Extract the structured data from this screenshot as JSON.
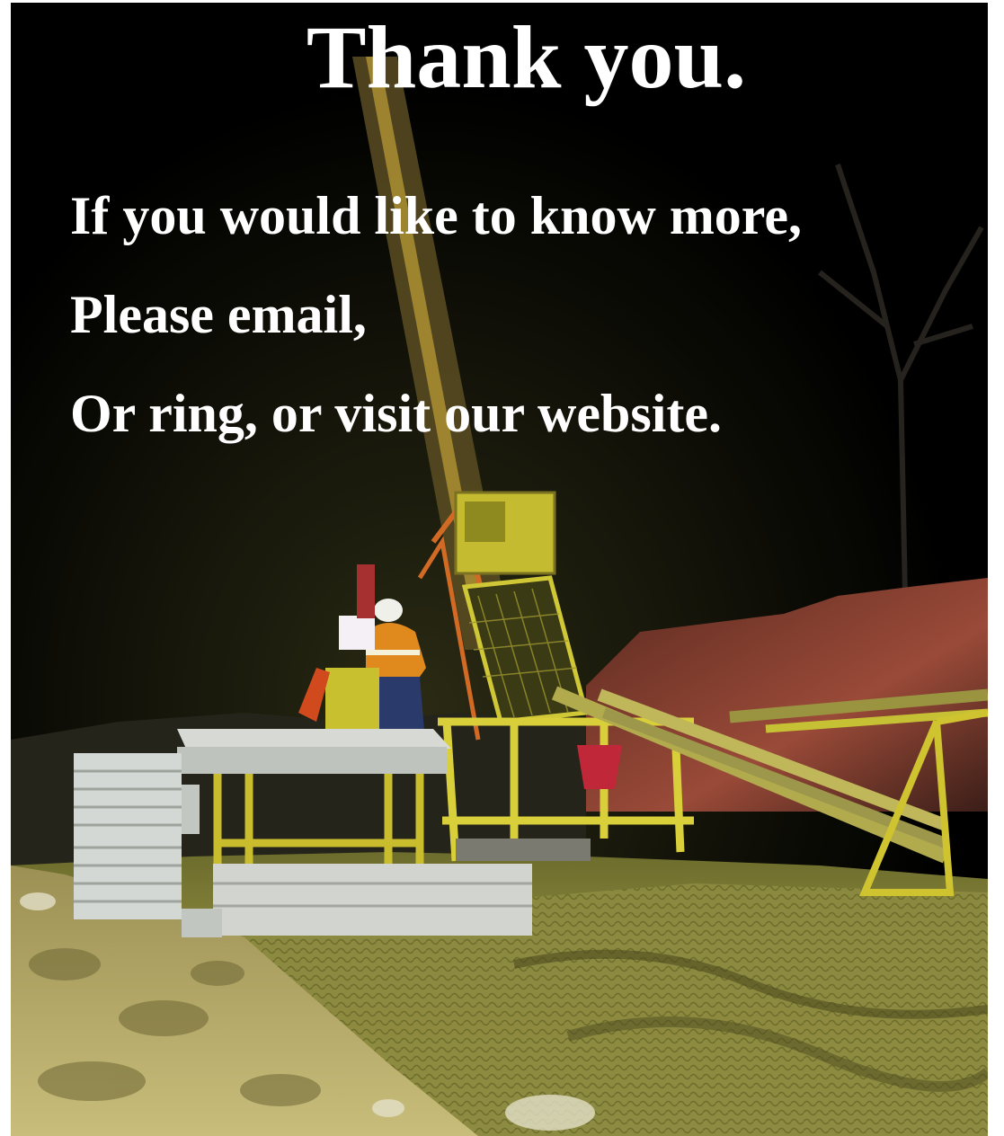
{
  "slide": {
    "title": "Thank you.",
    "lines": [
      "If you would like to know more,",
      "Please email,",
      "Or ring, or visit our website."
    ]
  },
  "photo": {
    "subject": "drill-rig-at-night-icon",
    "colors": {
      "sky": "#000000",
      "ground": "#8a8a3a",
      "rig_yellow": "#c9c23a",
      "hi_vis_orange": "#e08a1e",
      "rock_red": "#8a3a2e",
      "pallet_white": "#d8dcd8"
    }
  }
}
